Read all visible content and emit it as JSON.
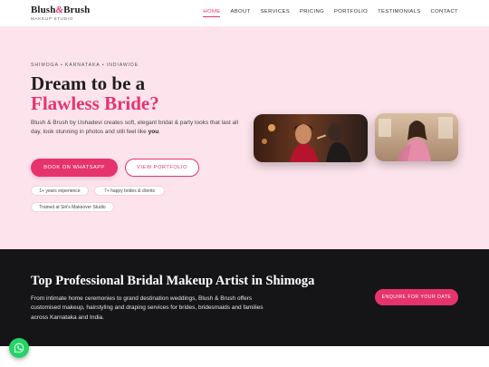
{
  "brand": {
    "name_part1": "Blush",
    "name_amp": "&",
    "name_part2": "Brush",
    "tagline": "MAKEUP STUDIO"
  },
  "nav": {
    "items": [
      {
        "label": "HOME",
        "active": true
      },
      {
        "label": "ABOUT",
        "active": false
      },
      {
        "label": "SERVICES",
        "active": false
      },
      {
        "label": "PRICING",
        "active": false
      },
      {
        "label": "PORTFOLIO",
        "active": false
      },
      {
        "label": "TESTIMONIALS",
        "active": false
      },
      {
        "label": "CONTACT",
        "active": false
      }
    ]
  },
  "hero": {
    "eyebrow": "SHIMOGA • KARNATAKA • INDIAWIDE",
    "headline_line1": "Dream to be a",
    "headline_line2": "Flawless Bride?",
    "intro_text": "Blush & Brush by Ushadevi creates soft, elegant bridal & party looks that last all day, look stunning in photos and still feel like ",
    "intro_emphasis": "you",
    "intro_end": ".",
    "primary_button": "BOOK ON WHATSAPP",
    "secondary_button": "VIEW PORTFOLIO",
    "pills": [
      "1+ years experience",
      "7+ happy brides & clients",
      "Trained at Siri's Makeover Studio"
    ]
  },
  "section": {
    "title": "Top Professional Bridal Makeup Artist in Shimoga",
    "body": "From intimate home ceremonies to grand destination weddings, Blush & Brush offers customised makeup, hairstyling and draping services for brides, bridesmaids and families across Karnataka and India.",
    "button": "ENQUIRE FOR YOUR DATE"
  },
  "floating": {
    "icon": "whatsapp-icon"
  },
  "colors": {
    "accent": "#e6336e",
    "hero_bg": "#fde4ec",
    "dark_bg": "#151517",
    "whatsapp": "#25d366"
  }
}
